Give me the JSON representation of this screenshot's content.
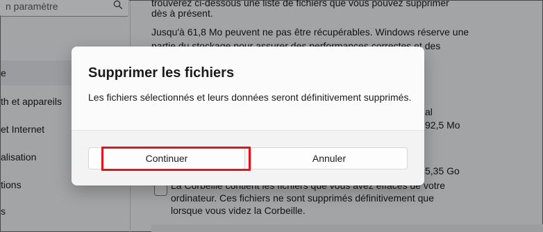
{
  "settings": {
    "search_placeholder": "n paramètre",
    "nav_items": [
      {
        "label": "e"
      },
      {
        "label": "th et appareils"
      },
      {
        "label": "et Internet"
      },
      {
        "label": "alisation"
      },
      {
        "label": "tions"
      },
      {
        "label": "s"
      }
    ],
    "content": {
      "line1": "trouverez ci-dessous une liste de fichiers que vous pouvez supprimer",
      "line2": "dès à présent.",
      "line3": "Jusqu'à 61,8 Mo peuvent ne pas être récupérables. Windows réserve une",
      "line4": "partie du stockage pour assurer des performances correctes et des",
      "value_partial": "al",
      "value_size1": "92,5 Mo",
      "value_size2": "5,35 Go",
      "recycle_line1": "La Corbeille contient les fichiers que vous avez effacés de votre",
      "recycle_line2": "ordinateur. Ces fichiers ne sont supprimés définitivement que",
      "recycle_line3": "lorsque vous videz la Corbeille."
    }
  },
  "dialog": {
    "title": "Supprimer les fichiers",
    "message": "Les fichiers sélectionnés et leurs données seront définitivement supprimés.",
    "continue_label": "Continuer",
    "cancel_label": "Annuler"
  },
  "colors": {
    "highlight": "#e0141e",
    "scrim": "rgba(0,0,0,0.32)"
  }
}
